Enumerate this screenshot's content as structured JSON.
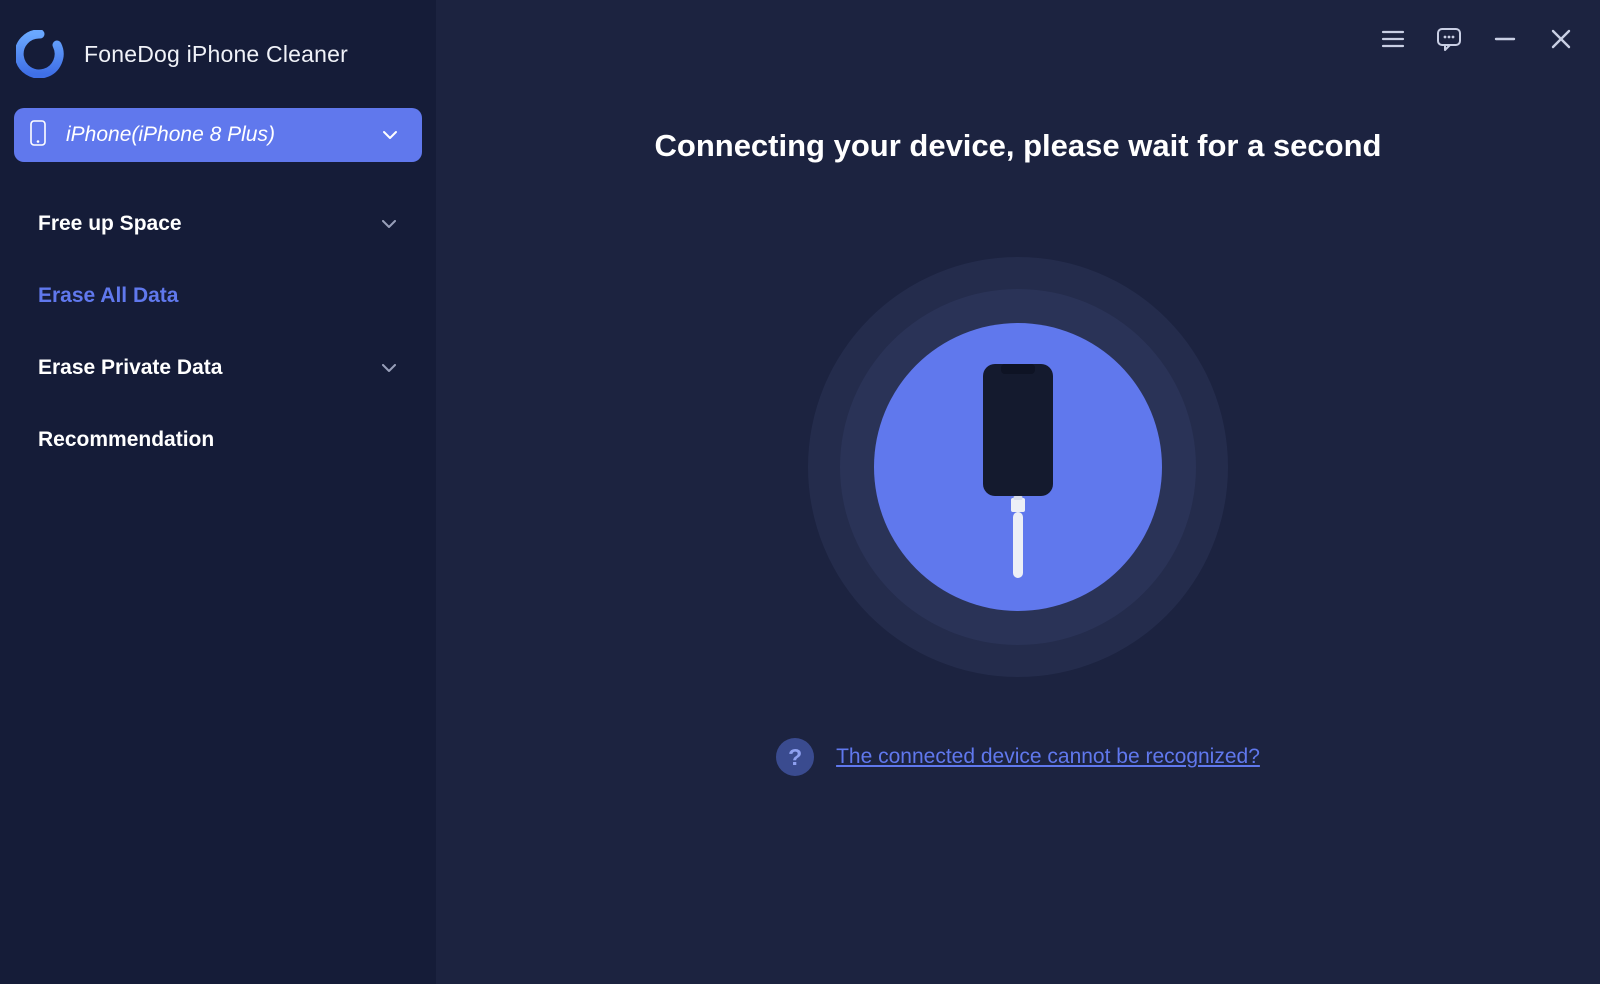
{
  "app": {
    "title": "FoneDog iPhone Cleaner"
  },
  "device": {
    "label": "iPhone(iPhone 8 Plus)"
  },
  "nav": {
    "free_up_space": "Free up Space",
    "erase_all_data": "Erase All Data",
    "erase_private_data": "Erase Private Data",
    "recommendation": "Recommendation"
  },
  "main": {
    "heading": "Connecting your device, please wait for a second",
    "help_link": "The connected device cannot be recognized?",
    "help_symbol": "?"
  },
  "colors": {
    "accent": "#6078ed",
    "sidebar_bg": "#151c38",
    "main_bg": "#1c2340"
  }
}
